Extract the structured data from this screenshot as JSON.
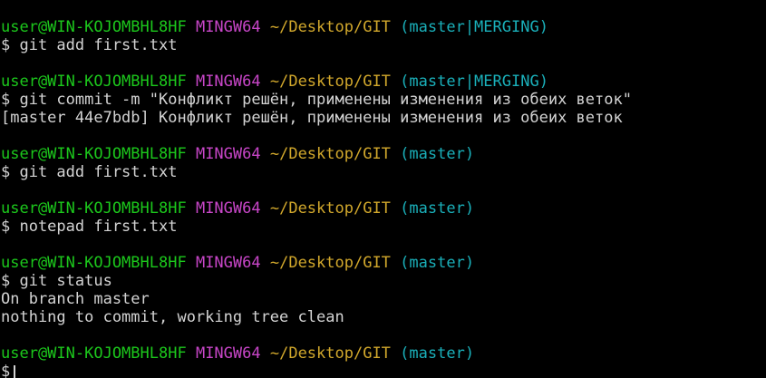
{
  "colors": {
    "background": "#000000",
    "user_host": "#1cc81c",
    "mingw": "#c846c8",
    "path": "#d2a82c",
    "branch": "#1ab0ba",
    "text": "#d3d3d3"
  },
  "blocks": [
    {
      "prompt": {
        "user": "user@WIN-KOJOMBHL8HF",
        "env": "MINGW64",
        "path": "~/Desktop/GIT",
        "branch": "(master|MERGING)"
      },
      "command": "$ git add first.txt",
      "output": []
    },
    {
      "prompt": {
        "user": "user@WIN-KOJOMBHL8HF",
        "env": "MINGW64",
        "path": "~/Desktop/GIT",
        "branch": "(master|MERGING)"
      },
      "command": "$ git commit -m \"Конфликт решён, применены изменения из обеих веток\"",
      "output": [
        "[master 44e7bdb] Конфликт решён, применены изменения из обеих веток"
      ]
    },
    {
      "prompt": {
        "user": "user@WIN-KOJOMBHL8HF",
        "env": "MINGW64",
        "path": "~/Desktop/GIT",
        "branch": "(master)"
      },
      "command": "$ git add first.txt",
      "output": []
    },
    {
      "prompt": {
        "user": "user@WIN-KOJOMBHL8HF",
        "env": "MINGW64",
        "path": "~/Desktop/GIT",
        "branch": "(master)"
      },
      "command": "$ notepad first.txt",
      "output": []
    },
    {
      "prompt": {
        "user": "user@WIN-KOJOMBHL8HF",
        "env": "MINGW64",
        "path": "~/Desktop/GIT",
        "branch": "(master)"
      },
      "command": "$ git status",
      "output": [
        "On branch master",
        "nothing to commit, working tree clean"
      ]
    },
    {
      "prompt": {
        "user": "user@WIN-KOJOMBHL8HF",
        "env": "MINGW64",
        "path": "~/Desktop/GIT",
        "branch": "(master)"
      },
      "command": "$",
      "output": []
    }
  ]
}
